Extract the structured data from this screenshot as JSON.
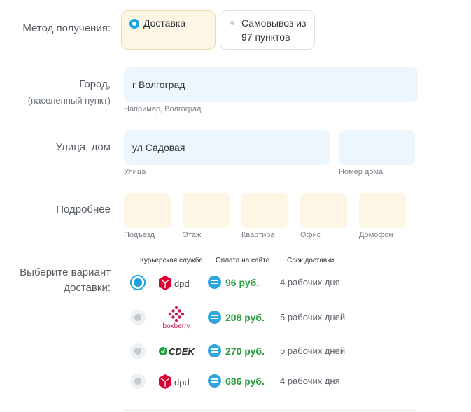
{
  "method": {
    "label": "Метод получения:",
    "delivery_label": "Доставка",
    "pickup_line1": "Самовывоз из",
    "pickup_line2": "97 пунктов"
  },
  "city": {
    "label": "Город,",
    "sublabel": "(населенный пункт)",
    "value": "г Волгоград",
    "hint": "Например, Волгоград"
  },
  "street": {
    "label": "Улица, дом",
    "value": "ул Садовая",
    "hint_street": "Улица",
    "house_value": "",
    "hint_house": "Номер дома"
  },
  "details": {
    "label": "Подробнее",
    "fields": [
      {
        "value": "",
        "hint": "Подъезд"
      },
      {
        "value": "",
        "hint": "Этаж"
      },
      {
        "value": "",
        "hint": "Квартира"
      },
      {
        "value": "",
        "hint": "Офис"
      },
      {
        "value": "",
        "hint": "Домофон"
      }
    ]
  },
  "shipping": {
    "label_line1": "Выберите вариант",
    "label_line2": "доставки:",
    "headers": {
      "courier": "Курьерская служба",
      "payment": "Оплата на сайте",
      "term": "Срок доставки"
    },
    "options": [
      {
        "courier": "dpd",
        "price": "96 руб.",
        "term": "4 рабочих дня",
        "selected": true
      },
      {
        "courier": "boxberry",
        "price": "208 руб.",
        "term": "5 рабочих дней",
        "selected": false
      },
      {
        "courier": "CDEK",
        "price": "270 руб.",
        "term": "5 рабочих дней",
        "selected": false
      },
      {
        "courier": "dpd",
        "price": "686 руб.",
        "term": "4 рабочих дня",
        "selected": false
      }
    ]
  },
  "colors": {
    "accent": "#1aa3e0",
    "price_green": "#2a9d3e",
    "dpd_red": "#dc0032",
    "boxberry_red": "#c2185b",
    "cdek_green": "#1fa340"
  }
}
